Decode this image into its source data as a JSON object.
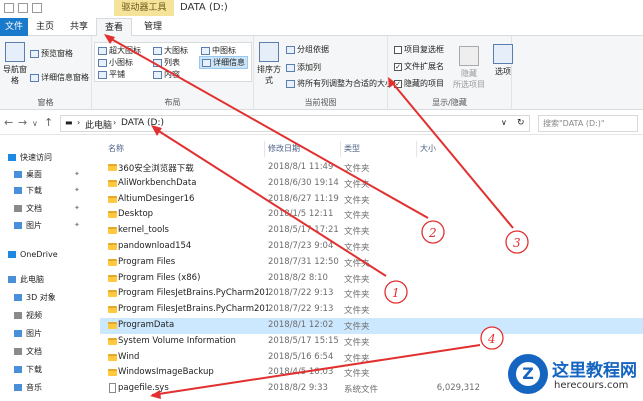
{
  "window": {
    "context_tab": "驱动器工具",
    "title": "DATA (D:)"
  },
  "tabs": [
    {
      "label": "文件"
    },
    {
      "label": "主页"
    },
    {
      "label": "共享"
    },
    {
      "label": "查看"
    },
    {
      "label": "管理"
    }
  ],
  "ribbon": {
    "panes": {
      "label": "窗格",
      "nav_pane": "导航窗格",
      "preview_pane": "预览窗格",
      "details_pane": "详细信息窗格"
    },
    "layout": {
      "label": "布局",
      "items": [
        "超大图标",
        "大图标",
        "中图标",
        "小图标",
        "列表",
        "详细信息",
        "平铺",
        "内容"
      ],
      "selected": "详细信息"
    },
    "current_view": {
      "label": "当前视图",
      "sort_by": "排序方式",
      "group_by": "分组依据",
      "add_column": "添加列",
      "fit_columns": "将所有列调整为合适的大小"
    },
    "show_hide": {
      "label": "显示/隐藏",
      "item_checkbox": "项目复选框",
      "file_ext": "文件扩展名",
      "hidden_items": "隐藏的项目",
      "hide_selected_line1": "隐藏",
      "hide_selected_line2": "所选项目",
      "options": "选项"
    }
  },
  "address": {
    "this_pc": "此电脑",
    "drive": "DATA (D:)",
    "search_placeholder": "搜索\"DATA (D:)\""
  },
  "nav_pane": [
    {
      "label": "快速访问",
      "icon": "star-icon",
      "color": "#1e88e5"
    },
    {
      "label": "桌面",
      "icon": "desktop-icon",
      "color": "#4a90d9",
      "pinned": true
    },
    {
      "label": "下载",
      "icon": "download-icon",
      "color": "#4a90d9",
      "pinned": true
    },
    {
      "label": "文档",
      "icon": "document-icon",
      "color": "#8a8a8a",
      "pinned": true
    },
    {
      "label": "图片",
      "icon": "picture-icon",
      "color": "#4a90d9",
      "pinned": true
    },
    {
      "label": "OneDrive",
      "icon": "cloud-icon",
      "color": "#1e88e5"
    },
    {
      "label": "此电脑",
      "icon": "computer-icon",
      "color": "#4a90d9"
    },
    {
      "label": "3D 对象",
      "icon": "cube-icon",
      "color": "#4a90d9"
    },
    {
      "label": "视频",
      "icon": "video-icon",
      "color": "#8a8a8a"
    },
    {
      "label": "图片",
      "icon": "picture-icon",
      "color": "#4a90d9"
    },
    {
      "label": "文档",
      "icon": "document-icon",
      "color": "#8a8a8a"
    },
    {
      "label": "下载",
      "icon": "download-icon",
      "color": "#4a90d9"
    },
    {
      "label": "音乐",
      "icon": "music-icon",
      "color": "#4a90d9"
    }
  ],
  "columns": {
    "name": "名称",
    "date": "修改日期",
    "type": "类型",
    "size": "大小"
  },
  "files": [
    {
      "name": "360安全浏览器下载",
      "date": "2018/8/1 11:49",
      "type": "文件夹",
      "size": "",
      "kind": "folder"
    },
    {
      "name": "AliWorkbenchData",
      "date": "2018/6/30 19:14",
      "type": "文件夹",
      "size": "",
      "kind": "folder"
    },
    {
      "name": "AltiumDesinger16",
      "date": "2018/6/27 11:19",
      "type": "文件夹",
      "size": "",
      "kind": "folder"
    },
    {
      "name": "Desktop",
      "date": "2018/1/5 12:11",
      "type": "文件夹",
      "size": "",
      "kind": "folder"
    },
    {
      "name": "kernel_tools",
      "date": "2018/5/17 17:21",
      "type": "文件夹",
      "size": "",
      "kind": "folder"
    },
    {
      "name": "pandownload154",
      "date": "2018/7/23 9:04",
      "type": "文件夹",
      "size": "",
      "kind": "folder"
    },
    {
      "name": "Program Files",
      "date": "2018/7/31 12:50",
      "type": "文件夹",
      "size": "",
      "kind": "folder"
    },
    {
      "name": "Program Files (x86)",
      "date": "2018/8/2 8:10",
      "type": "文件夹",
      "size": "",
      "kind": "folder"
    },
    {
      "name": "Program FilesJetBrains.PyCharm2018...",
      "date": "2018/7/22 9:13",
      "type": "文件夹",
      "size": "",
      "kind": "folder"
    },
    {
      "name": "Program FilesJetBrains.PyCharm2018...",
      "date": "2018/7/22 9:13",
      "type": "文件夹",
      "size": "",
      "kind": "folder"
    },
    {
      "name": "ProgramData",
      "date": "2018/8/1 12:02",
      "type": "文件夹",
      "size": "",
      "kind": "folder",
      "selected": true
    },
    {
      "name": "System Volume Information",
      "date": "2018/5/17 15:15",
      "type": "文件夹",
      "size": "",
      "kind": "folder"
    },
    {
      "name": "Wind",
      "date": "2018/5/16 6:54",
      "type": "文件夹",
      "size": "",
      "kind": "folder"
    },
    {
      "name": "WindowsImageBackup",
      "date": "2018/4/5 10:03",
      "type": "文件夹",
      "size": "",
      "kind": "folder"
    },
    {
      "name": "pagefile.sys",
      "date": "2018/8/2 9:33",
      "type": "系统文件",
      "size": "6,029,312",
      "kind": "file"
    }
  ],
  "annotations": [
    "1",
    "2",
    "3",
    "4"
  ],
  "watermark": {
    "logo_letter": "Z",
    "title": "这里教程网",
    "url": "herecours.com"
  },
  "colors": {
    "annotation": "#e23030",
    "file_tab": "#1979ca",
    "context_tab": "#f6e39a",
    "selection": "#cce8ff",
    "watermark_blue": "#1565c0"
  }
}
